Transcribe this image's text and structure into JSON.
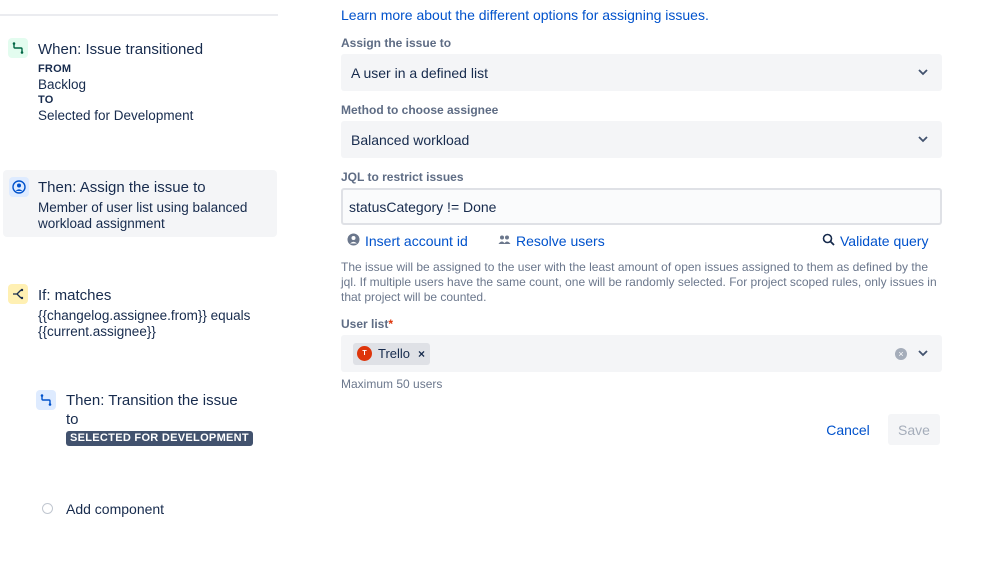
{
  "rule": {
    "trigger": {
      "title": "When: Issue transitioned",
      "from_label": "FROM",
      "from_value": "Backlog",
      "to_label": "TO",
      "to_value": "Selected for Development"
    },
    "action_assign": {
      "title": "Then: Assign the issue to",
      "description_line1": "Member of user list using balanced",
      "description_line2": "workload assignment"
    },
    "condition": {
      "title": "If: matches",
      "line1": "{{changelog.assignee.from}} equals",
      "line2": "{{current.assignee}}"
    },
    "action_transition": {
      "title_line1": "Then: Transition the issue",
      "title_line2": "to",
      "status": "SELECTED FOR DEVELOPMENT"
    },
    "add_component": "Add component"
  },
  "panel": {
    "learn_more": "Learn more about the different options for assigning issues.",
    "assign_label": "Assign the issue to",
    "assign_value": "A user in a defined list",
    "method_label": "Method to choose assignee",
    "method_value": "Balanced workload",
    "jql_label": "JQL to restrict issues",
    "jql_value": "statusCategory != Done",
    "insert_account": "Insert account id",
    "resolve_users": "Resolve users",
    "validate_query": "Validate query",
    "help_text": "The issue will be assigned to the user with the least amount of open issues assigned to them as defined by the jql. If multiple users have the same count, one will be randomly selected. For project scoped rules, only issues in that project will be counted.",
    "user_list_label": "User list",
    "required_mark": "*",
    "user_tag": "Trello",
    "user_avatar_letter": "T",
    "max_users": "Maximum 50 users",
    "cancel": "Cancel",
    "save": "Save"
  },
  "icons": {
    "trigger": "transition-icon",
    "assign": "user-avatar-icon",
    "condition": "branch-icon",
    "transition": "transition-icon",
    "chevron": "chevron-down-icon",
    "person": "person-icon",
    "people": "people-icon",
    "search": "search-icon",
    "clear": "clear-icon"
  },
  "colors": {
    "link": "#0052cc",
    "text": "#172b4d",
    "subtle": "#5e6c84",
    "field_bg": "#f4f5f7",
    "lozenge": "#42526e",
    "avatar": "#de350b",
    "required": "#de350b"
  }
}
